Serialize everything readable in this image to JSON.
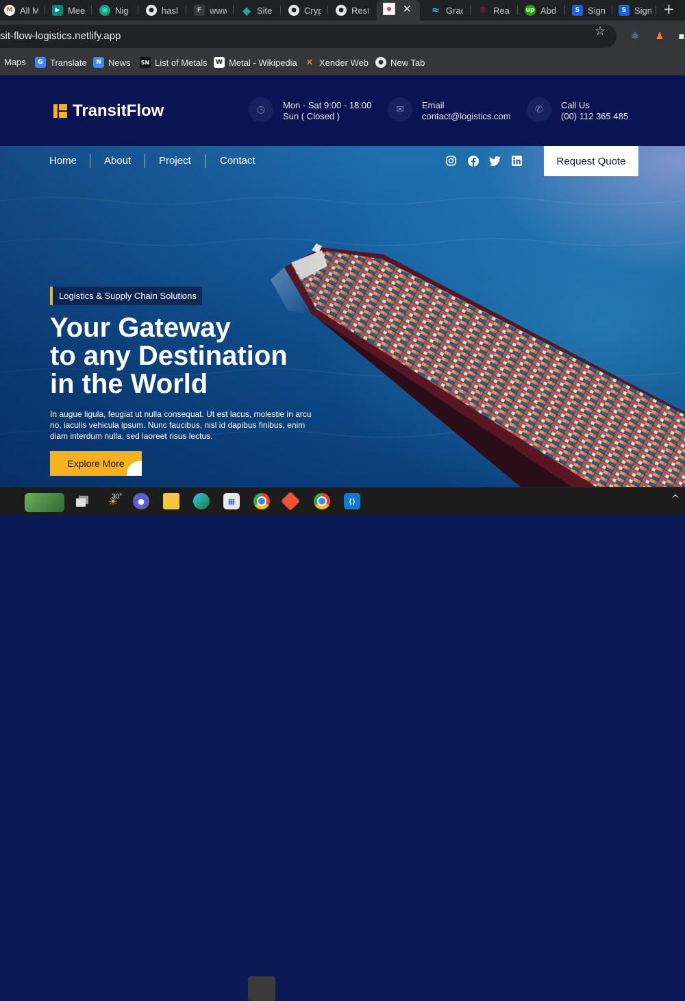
{
  "browser": {
    "tabs": [
      {
        "label": "All M",
        "icon": "gmail-icon",
        "color": "#ea4335",
        "glyph": "M"
      },
      {
        "label": "Mee",
        "icon": "meet-icon",
        "color": "#00897b",
        "glyph": "▶"
      },
      {
        "label": "Nig",
        "icon": "chatgpt-icon",
        "color": "#10a37f",
        "glyph": "◎"
      },
      {
        "label": "hasl",
        "icon": "globe-icon",
        "color": "#5f6368",
        "glyph": "●"
      },
      {
        "label": "www",
        "icon": "figma-icon",
        "color": "#a259ff",
        "glyph": "F"
      },
      {
        "label": "Site",
        "icon": "netlify-icon",
        "color": "#26a69a",
        "glyph": "◆"
      },
      {
        "label": "Cryp",
        "icon": "globe-icon",
        "color": "#5f6368",
        "glyph": "●"
      },
      {
        "label": "Rest",
        "icon": "globe-icon",
        "color": "#5f6368",
        "glyph": "●"
      },
      {
        "label": "Grac",
        "icon": "tailwind-icon",
        "color": "#38bdf8",
        "glyph": "≈"
      },
      {
        "label": "Rea",
        "icon": "react-icon",
        "color": "#e91e63",
        "glyph": "⚛"
      },
      {
        "label": "Abd",
        "icon": "upwork-icon",
        "color": "#14a800",
        "glyph": "up"
      },
      {
        "label": "Sign",
        "icon": "vscode-tab-icon",
        "color": "#1e63d6",
        "glyph": "S"
      },
      {
        "label": "Sign",
        "icon": "vscode-tab-icon",
        "color": "#1e63d6",
        "glyph": "S"
      }
    ],
    "active_tab_close": "✕",
    "new_tab": "+",
    "url": "sit-flow-logistics.netlify.app",
    "star": "☆",
    "bookmarks": [
      {
        "label": "Maps",
        "icon": "maps-icon",
        "color": "#34a853",
        "glyph": ""
      },
      {
        "label": "Translate",
        "icon": "translate-icon",
        "color": "#4285f4",
        "glyph": "G"
      },
      {
        "label": "News",
        "icon": "news-icon",
        "color": "#4285f4",
        "glyph": "N"
      },
      {
        "label": "List of Metals",
        "icon": "sn-icon",
        "color": "#111111",
        "glyph": "SN"
      },
      {
        "label": "Metal - Wikipedia",
        "icon": "wikipedia-icon",
        "color": "#ffffff",
        "glyph": "W"
      },
      {
        "label": "Xender Web",
        "icon": "xender-icon",
        "color": "#f5a623",
        "glyph": "✕"
      },
      {
        "label": "New Tab",
        "icon": "globe-icon",
        "color": "#9aa0a6",
        "glyph": "●"
      }
    ]
  },
  "site": {
    "brand": "TransitFlow",
    "hours": {
      "line1": "Mon - Sat 9:00 - 18:00",
      "line2": "Sun ( Closed )"
    },
    "email": {
      "label": "Email",
      "value": "contact@logistics.com"
    },
    "phone": {
      "label": "Call Us",
      "value": "(00) 112 365 485"
    },
    "nav": [
      "Home",
      "About",
      "Project",
      "Contact"
    ],
    "quote_button": "Request Quote",
    "badge": "Logistics & Supply Chain Solutions",
    "title_lines": [
      "Your Gateway",
      "to any Destination",
      "in the World"
    ],
    "body": "In augue ligula, feugiat ut nulla consequat. Ut est lacus, molestie in arcu no, iaculis vehicula ipsum. Nunc faucibus, nisl id dapibus finibus, enim diam interdum nulla, sed laoreet risus lectus.",
    "explore_button": "Explore More",
    "accent": "#f6b21d",
    "navy": "#0b1452"
  },
  "taskbar": {
    "weather_temp": "30°",
    "apps": [
      "start-icon",
      "task-view-icon",
      "weather-icon",
      "chat-icon",
      "file-explorer-icon",
      "edge-icon",
      "store-icon",
      "chrome-icon",
      "git-icon",
      "chrome-profile-icon",
      "vscode-icon"
    ],
    "tray_chevron": "^"
  }
}
